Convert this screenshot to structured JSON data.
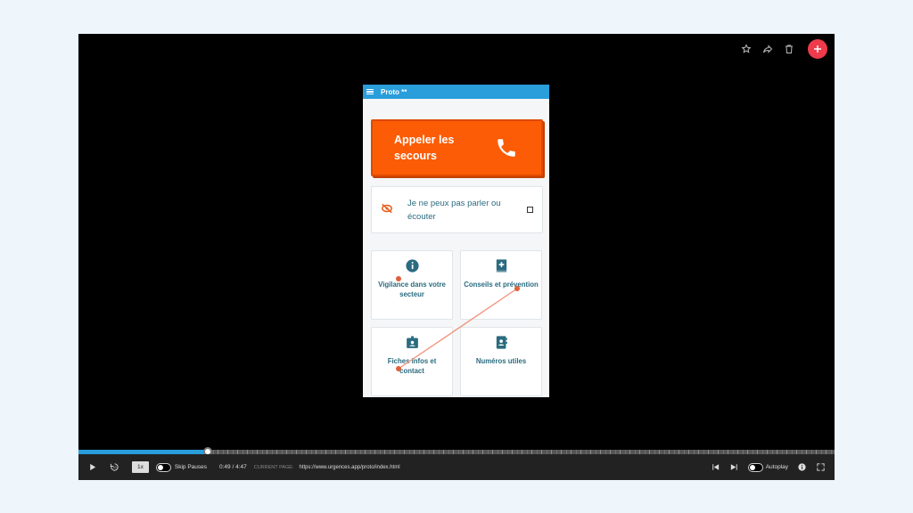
{
  "player": {
    "top_actions": {
      "star_icon": "star-icon",
      "share_icon": "share-icon",
      "trash_icon": "trash-icon",
      "add_icon": "plus-icon"
    },
    "controls": {
      "speed": "1x",
      "skip_pauses": "Skip Pauses",
      "time": "0:49 / 4:47",
      "current_page_label": "CURRENT PAGE:",
      "current_page_url": "https://www.urgences.app/proto/index.html",
      "autoplay": "Autoplay",
      "progress": 0.1707
    }
  },
  "app": {
    "title": "Proto **",
    "call_button": "Appeler les secours",
    "mute_card": "Je ne peux pas parler ou écouter",
    "tiles": [
      {
        "label": "Vigilance dans votre secteur",
        "icon": "info-icon"
      },
      {
        "label": "Conseils et prévention",
        "icon": "medical-book-icon"
      },
      {
        "label": "Fiches infos et contact",
        "icon": "id-badge-icon"
      },
      {
        "label": "Numéros utiles",
        "icon": "contact-book-icon"
      }
    ]
  },
  "colors": {
    "app_bar": "#2a9ddb",
    "call_button": "#fb5c05",
    "tile_text": "#2a6b7f",
    "fab": "#ee3a4b"
  }
}
